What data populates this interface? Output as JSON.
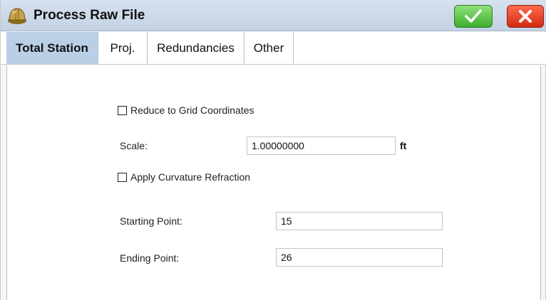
{
  "window": {
    "title": "Process Raw File",
    "ok_icon": "checkmark-icon",
    "cancel_icon": "close-x-icon",
    "app_icon": "hard-hat-icon",
    "colors": {
      "titlebar": "#c9d7e8",
      "ok": "#4cbb35",
      "cancel": "#e23a1e",
      "active_tab": "#b9cfe6"
    }
  },
  "tabs": [
    {
      "label": "Total Station",
      "active": true
    },
    {
      "label": "Proj.",
      "active": false
    },
    {
      "label": "Redundancies",
      "active": false
    },
    {
      "label": "Other",
      "active": false
    }
  ],
  "form": {
    "reduce_grid": {
      "label": "Reduce to Grid Coordinates",
      "checked": false
    },
    "scale": {
      "label": "Scale:",
      "value": "1.00000000",
      "unit": "ft"
    },
    "curvature": {
      "label": "Apply Curvature Refraction",
      "checked": false
    },
    "starting_point": {
      "label": "Starting Point:",
      "value": "15"
    },
    "ending_point": {
      "label": "Ending Point:",
      "value": "26"
    }
  }
}
